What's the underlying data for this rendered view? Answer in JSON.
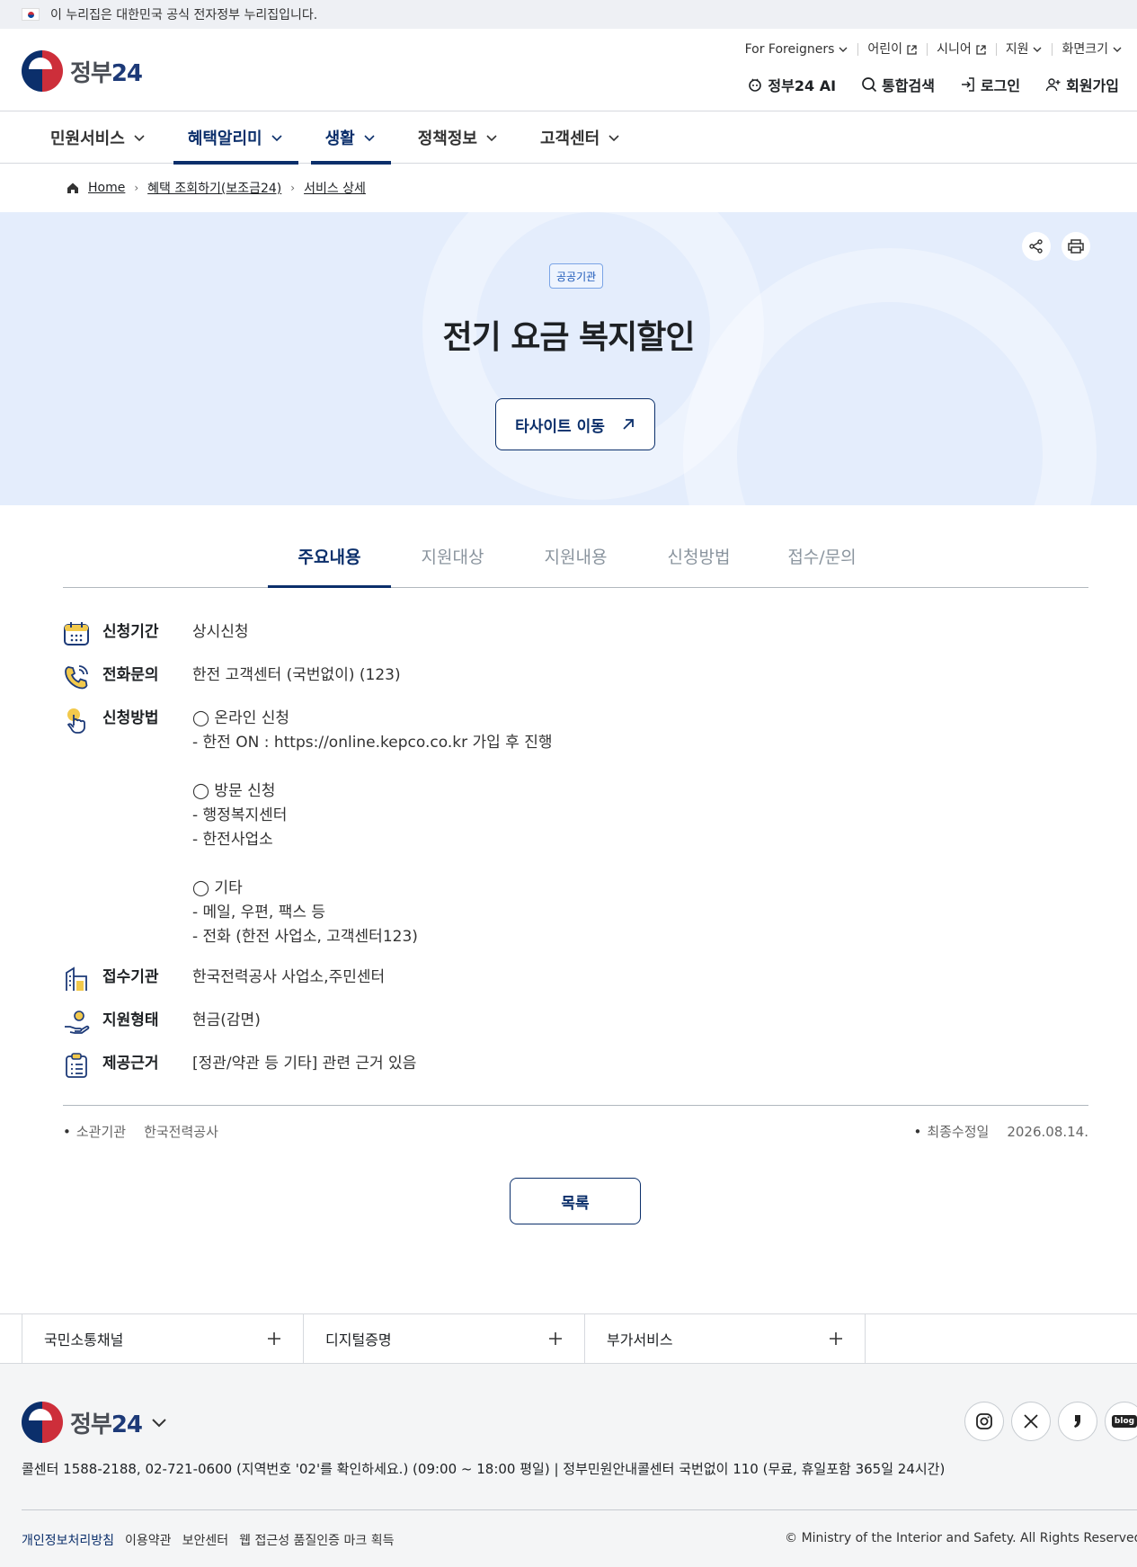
{
  "gov_banner": {
    "text": "이 누리집은 대한민국 공식 전자정부 누리집입니다."
  },
  "logo": {
    "text_main": "정부",
    "text_num": "24"
  },
  "util_top": [
    {
      "label": "For Foreigners",
      "icon": "chevron-down-icon"
    },
    {
      "label": "어린이",
      "icon": "external-link-icon"
    },
    {
      "label": "시니어",
      "icon": "external-link-icon"
    },
    {
      "label": "지원",
      "icon": "chevron-down-icon"
    },
    {
      "label": "화면크기",
      "icon": "chevron-down-icon"
    }
  ],
  "util_bottom": [
    {
      "label": "정부24 AI",
      "icon": "ai-icon"
    },
    {
      "label": "통합검색",
      "icon": "search-icon"
    },
    {
      "label": "로그인",
      "icon": "login-icon"
    },
    {
      "label": "회원가입",
      "icon": "user-plus-icon"
    }
  ],
  "gnb": [
    {
      "label": "민원서비스",
      "active": false
    },
    {
      "label": "혜택알리미",
      "active": true
    },
    {
      "label": "생활",
      "active": true
    },
    {
      "label": "정책정보",
      "active": false
    },
    {
      "label": "고객센터",
      "active": false
    }
  ],
  "breadcrumb": {
    "home": "Home",
    "level1": "혜택 조회하기(보조금24)",
    "level2": "서비스 상세"
  },
  "hero": {
    "badge": "공공기관",
    "title": "전기 요금 복지할인",
    "external_button": "타사이트 이동"
  },
  "tabs": [
    "주요내용",
    "지원대상",
    "지원내용",
    "신청방법",
    "접수/문의"
  ],
  "info": {
    "period": {
      "label": "신청기간",
      "value": "상시신청"
    },
    "phone": {
      "label": "전화문의",
      "value": "한전 고객센터 (국번없이) (123)"
    },
    "method": {
      "label": "신청방법",
      "value": "◯ 온라인 신청\n- 한전 ON : https://online.kepco.co.kr 가입 후 진행\n\n◯ 방문 신청\n- 행정복지센터\n- 한전사업소\n\n◯ 기타\n- 메일, 우편, 팩스 등\n- 전화 (한전 사업소, 고객센터123)"
    },
    "agency": {
      "label": "접수기관",
      "value": "한국전력공사 사업소,주민센터"
    },
    "type": {
      "label": "지원형태",
      "value": "현금(감면)"
    },
    "basis": {
      "label": "제공근거",
      "value": "[정관/약관 등 기타] 관련 근거 있음"
    }
  },
  "meta": {
    "owner_label": "소관기관",
    "owner_value": "한국전력공사",
    "updated_label": "최종수정일",
    "updated_value": "2026.08.14."
  },
  "list_button": "목록",
  "footer_links": [
    "국민소통채널",
    "디지털증명",
    "부가서비스"
  ],
  "footer": {
    "contact": "콜센터 1588-2188, 02-721-0600 (지역번호 '02'를 확인하세요.) (09:00 ~ 18:00 평일)  |  정부민원안내콜센터 국번없이 110 (무료, 휴일포함 365일 24시간)",
    "policy": [
      "개인정보처리방침",
      "이용약관",
      "보안센터",
      "웹 접근성 품질인증 마크 획득"
    ],
    "copyright": "© Ministry of the Interior and Safety. All Rights Reserved.",
    "sns": [
      "instagram-icon",
      "x-icon",
      "brunch-icon",
      "blog-icon"
    ],
    "blog_label": "blog"
  },
  "colors": {
    "primary": "#0b2f6b",
    "hero_bg": "#e4edfc",
    "accent_red": "#cd2e3a"
  }
}
